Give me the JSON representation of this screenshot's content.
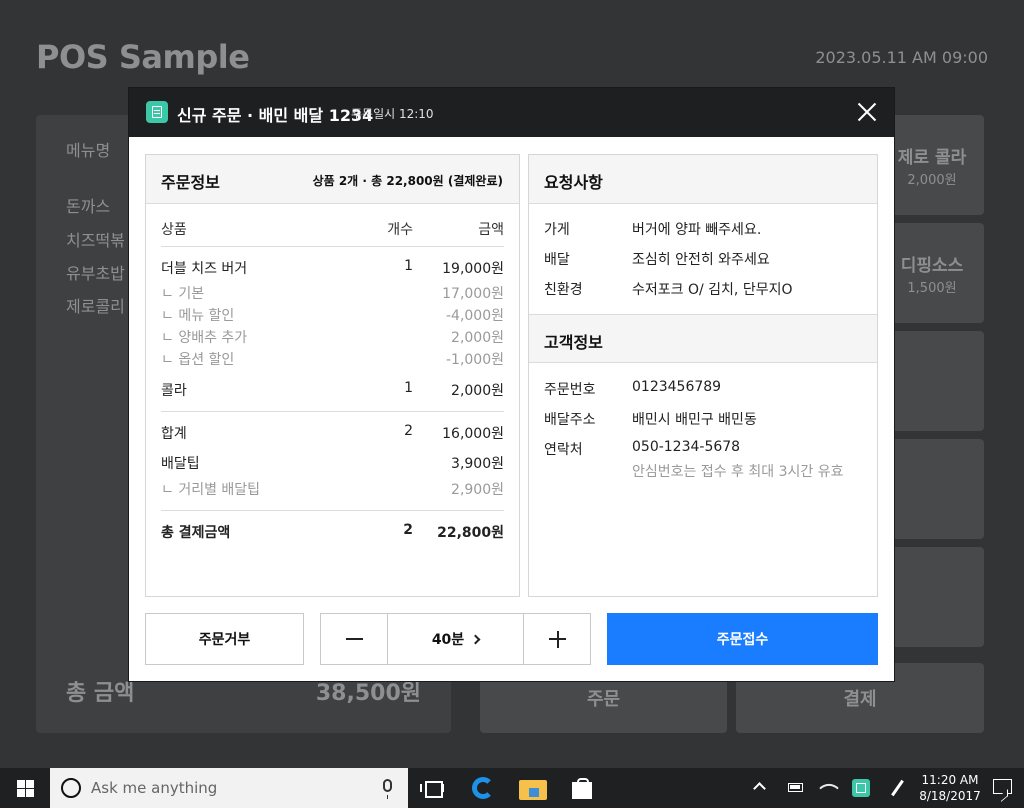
{
  "app": {
    "title": "POS Sample",
    "datetime": "2023.05.11 AM 09:00",
    "menu_header": "메뉴명",
    "menu_items": [
      "돈까스",
      "치즈떡볶",
      "유부초밥",
      "제로콜리"
    ],
    "total_label": "총 금액",
    "total_value": "38,500원",
    "tiles": [
      {
        "name": "제로 콜라",
        "price": "2,000원"
      },
      {
        "name": "디핑소스",
        "price": "1,500원"
      }
    ],
    "order_button": "주문",
    "pay_button": "결제"
  },
  "modal": {
    "title": "신규 주문 · 배민 배달 1234",
    "order_time": "주문일시 12:10",
    "order_info": {
      "title": "주문정보",
      "summary": "상품 2개 · 총 22,800원 (결제완료)",
      "columns": {
        "item": "상품",
        "qty": "개수",
        "amount": "금액"
      },
      "rows": [
        {
          "name": "더블 치즈 버거",
          "qty": "1",
          "amount": "19,000원",
          "type": "main"
        },
        {
          "name": "ㄴ 기본",
          "qty": "",
          "amount": "17,000원",
          "type": "sub"
        },
        {
          "name": "ㄴ 메뉴 할인",
          "qty": "",
          "amount": "-4,000원",
          "type": "sub"
        },
        {
          "name": "ㄴ 양배추 추가",
          "qty": "",
          "amount": "2,000원",
          "type": "sub"
        },
        {
          "name": "ㄴ 옵션 할인",
          "qty": "",
          "amount": "-1,000원",
          "type": "sub"
        },
        {
          "name": "콜라",
          "qty": "1",
          "amount": "2,000원",
          "type": "main"
        }
      ],
      "subtotal": {
        "name": "합계",
        "qty": "2",
        "amount": "16,000원"
      },
      "delivery_tip": {
        "name": "배달팁",
        "qty": "",
        "amount": "3,900원"
      },
      "distance_tip": {
        "name": "ㄴ 거리별 배달팁",
        "qty": "",
        "amount": "2,900원"
      },
      "grand_total": {
        "name": "총 결제금액",
        "qty": "2",
        "amount": "22,800원"
      }
    },
    "requests": {
      "title": "요청사항",
      "items": [
        {
          "key": "가게",
          "value": "버거에 양파 빼주세요."
        },
        {
          "key": "배달",
          "value": "조심히 안전히 와주세요"
        },
        {
          "key": "친환경",
          "value": "수저포크 O/ 김치, 단무지O"
        }
      ]
    },
    "customer": {
      "title": "고객정보",
      "items": [
        {
          "key": "주문번호",
          "value": "0123456789"
        },
        {
          "key": "배달주소",
          "value": "배민시 배민구 배민동"
        },
        {
          "key": "연락처",
          "value": "050-1234-5678"
        }
      ],
      "contact_note": "안심번호는 접수 후 최대 3시간 유효"
    },
    "reject_button": "주문거부",
    "eta_value": "40분",
    "accept_button": "주문접수"
  },
  "taskbar": {
    "search_placeholder": "Ask me anything",
    "time": "11:20 AM",
    "date": "8/18/2017"
  }
}
